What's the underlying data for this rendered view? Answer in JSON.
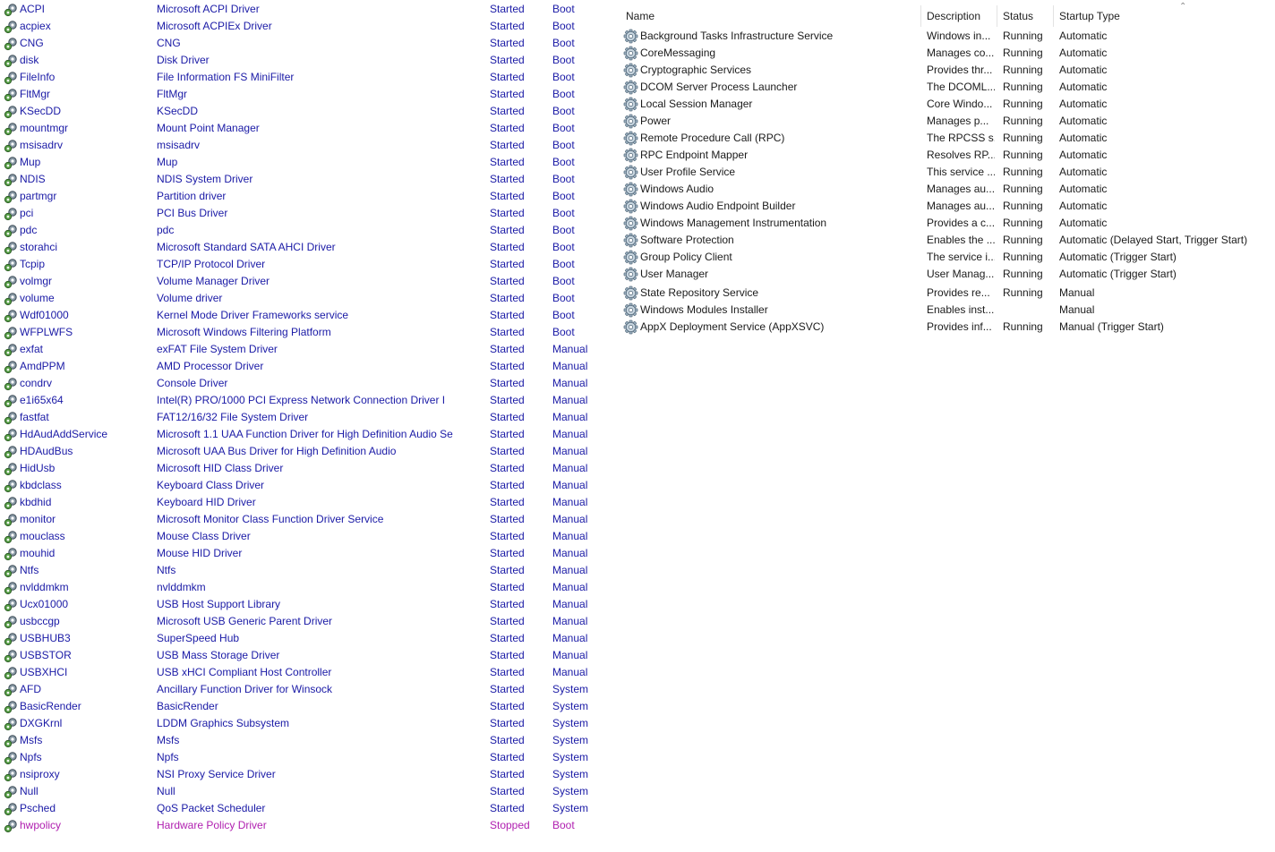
{
  "drivers": [
    {
      "name": "ACPI",
      "desc": "Microsoft ACPI Driver",
      "status": "Started",
      "start": "Boot"
    },
    {
      "name": "acpiex",
      "desc": "Microsoft ACPIEx Driver",
      "status": "Started",
      "start": "Boot"
    },
    {
      "name": "CNG",
      "desc": "CNG",
      "status": "Started",
      "start": "Boot"
    },
    {
      "name": "disk",
      "desc": "Disk Driver",
      "status": "Started",
      "start": "Boot"
    },
    {
      "name": "FileInfo",
      "desc": "File Information FS MiniFilter",
      "status": "Started",
      "start": "Boot"
    },
    {
      "name": "FltMgr",
      "desc": "FltMgr",
      "status": "Started",
      "start": "Boot"
    },
    {
      "name": "KSecDD",
      "desc": "KSecDD",
      "status": "Started",
      "start": "Boot"
    },
    {
      "name": "mountmgr",
      "desc": "Mount Point Manager",
      "status": "Started",
      "start": "Boot"
    },
    {
      "name": "msisadrv",
      "desc": "msisadrv",
      "status": "Started",
      "start": "Boot"
    },
    {
      "name": "Mup",
      "desc": "Mup",
      "status": "Started",
      "start": "Boot"
    },
    {
      "name": "NDIS",
      "desc": "NDIS System Driver",
      "status": "Started",
      "start": "Boot"
    },
    {
      "name": "partmgr",
      "desc": "Partition driver",
      "status": "Started",
      "start": "Boot"
    },
    {
      "name": "pci",
      "desc": "PCI Bus Driver",
      "status": "Started",
      "start": "Boot"
    },
    {
      "name": "pdc",
      "desc": "pdc",
      "status": "Started",
      "start": "Boot"
    },
    {
      "name": "storahci",
      "desc": "Microsoft Standard SATA AHCI Driver",
      "status": "Started",
      "start": "Boot"
    },
    {
      "name": "Tcpip",
      "desc": "TCP/IP Protocol Driver",
      "status": "Started",
      "start": "Boot"
    },
    {
      "name": "volmgr",
      "desc": "Volume Manager Driver",
      "status": "Started",
      "start": "Boot"
    },
    {
      "name": "volume",
      "desc": "Volume driver",
      "status": "Started",
      "start": "Boot"
    },
    {
      "name": "Wdf01000",
      "desc": "Kernel Mode Driver Frameworks service",
      "status": "Started",
      "start": "Boot"
    },
    {
      "name": "WFPLWFS",
      "desc": "Microsoft Windows Filtering Platform",
      "status": "Started",
      "start": "Boot"
    },
    {
      "name": "exfat",
      "desc": "exFAT File System Driver",
      "status": "Started",
      "start": "Manual"
    },
    {
      "name": "AmdPPM",
      "desc": "AMD Processor Driver",
      "status": "Started",
      "start": "Manual"
    },
    {
      "name": "condrv",
      "desc": "Console Driver",
      "status": "Started",
      "start": "Manual"
    },
    {
      "name": "e1i65x64",
      "desc": "Intel(R) PRO/1000 PCI Express Network Connection Driver I",
      "status": "Started",
      "start": "Manual"
    },
    {
      "name": "fastfat",
      "desc": "FAT12/16/32 File System Driver",
      "status": "Started",
      "start": "Manual"
    },
    {
      "name": "HdAudAddService",
      "desc": "Microsoft 1.1 UAA Function Driver for High Definition Audio Se",
      "status": "Started",
      "start": "Manual"
    },
    {
      "name": "HDAudBus",
      "desc": "Microsoft UAA Bus Driver for High Definition Audio",
      "status": "Started",
      "start": "Manual"
    },
    {
      "name": "HidUsb",
      "desc": "Microsoft HID Class Driver",
      "status": "Started",
      "start": "Manual"
    },
    {
      "name": "kbdclass",
      "desc": "Keyboard Class Driver",
      "status": "Started",
      "start": "Manual"
    },
    {
      "name": "kbdhid",
      "desc": "Keyboard HID Driver",
      "status": "Started",
      "start": "Manual"
    },
    {
      "name": "monitor",
      "desc": "Microsoft Monitor Class Function Driver Service",
      "status": "Started",
      "start": "Manual"
    },
    {
      "name": "mouclass",
      "desc": "Mouse Class Driver",
      "status": "Started",
      "start": "Manual"
    },
    {
      "name": "mouhid",
      "desc": "Mouse HID Driver",
      "status": "Started",
      "start": "Manual"
    },
    {
      "name": "Ntfs",
      "desc": "Ntfs",
      "status": "Started",
      "start": "Manual"
    },
    {
      "name": "nvlddmkm",
      "desc": "nvlddmkm",
      "status": "Started",
      "start": "Manual"
    },
    {
      "name": "Ucx01000",
      "desc": "USB Host Support Library",
      "status": "Started",
      "start": "Manual"
    },
    {
      "name": "usbccgp",
      "desc": "Microsoft USB Generic Parent Driver",
      "status": "Started",
      "start": "Manual"
    },
    {
      "name": "USBHUB3",
      "desc": "SuperSpeed Hub",
      "status": "Started",
      "start": "Manual"
    },
    {
      "name": "USBSTOR",
      "desc": "USB Mass Storage Driver",
      "status": "Started",
      "start": "Manual"
    },
    {
      "name": "USBXHCI",
      "desc": "USB xHCI Compliant Host Controller",
      "status": "Started",
      "start": "Manual"
    },
    {
      "name": "AFD",
      "desc": "Ancillary Function Driver for Winsock",
      "status": "Started",
      "start": "System"
    },
    {
      "name": "BasicRender",
      "desc": "BasicRender",
      "status": "Started",
      "start": "System"
    },
    {
      "name": "DXGKrnl",
      "desc": "LDDM Graphics Subsystem",
      "status": "Started",
      "start": "System"
    },
    {
      "name": "Msfs",
      "desc": "Msfs",
      "status": "Started",
      "start": "System"
    },
    {
      "name": "Npfs",
      "desc": "Npfs",
      "status": "Started",
      "start": "System"
    },
    {
      "name": "nsiproxy",
      "desc": "NSI Proxy Service Driver",
      "status": "Started",
      "start": "System"
    },
    {
      "name": "Null",
      "desc": "Null",
      "status": "Started",
      "start": "System"
    },
    {
      "name": "Psched",
      "desc": "QoS Packet Scheduler",
      "status": "Started",
      "start": "System"
    },
    {
      "name": "hwpolicy",
      "desc": "Hardware Policy Driver",
      "status": "Stopped",
      "start": "Boot"
    }
  ],
  "services": {
    "columns": {
      "name": "Name",
      "description": "Description",
      "status": "Status",
      "startup": "Startup Type"
    },
    "rows": [
      {
        "name": "Background Tasks Infrastructure Service",
        "desc": "Windows in...",
        "status": "Running",
        "start": "Automatic"
      },
      {
        "name": "CoreMessaging",
        "desc": "Manages co...",
        "status": "Running",
        "start": "Automatic"
      },
      {
        "name": "Cryptographic Services",
        "desc": "Provides thr...",
        "status": "Running",
        "start": "Automatic"
      },
      {
        "name": "DCOM Server Process Launcher",
        "desc": "The DCOML...",
        "status": "Running",
        "start": "Automatic"
      },
      {
        "name": "Local Session Manager",
        "desc": "Core Windo...",
        "status": "Running",
        "start": "Automatic"
      },
      {
        "name": "Power",
        "desc": "Manages p...",
        "status": "Running",
        "start": "Automatic"
      },
      {
        "name": "Remote Procedure Call (RPC)",
        "desc": "The RPCSS s...",
        "status": "Running",
        "start": "Automatic"
      },
      {
        "name": "RPC Endpoint Mapper",
        "desc": "Resolves RP...",
        "status": "Running",
        "start": "Automatic"
      },
      {
        "name": "User Profile Service",
        "desc": "This service ...",
        "status": "Running",
        "start": "Automatic"
      },
      {
        "name": "Windows Audio",
        "desc": "Manages au...",
        "status": "Running",
        "start": "Automatic"
      },
      {
        "name": "Windows Audio Endpoint Builder",
        "desc": "Manages au...",
        "status": "Running",
        "start": "Automatic"
      },
      {
        "name": "Windows Management Instrumentation",
        "desc": "Provides a c...",
        "status": "Running",
        "start": "Automatic"
      },
      {
        "name": "Software Protection",
        "desc": "Enables the ...",
        "status": "Running",
        "start": "Automatic (Delayed Start, Trigger Start)"
      },
      {
        "name": "Group Policy Client",
        "desc": "The service i...",
        "status": "Running",
        "start": "Automatic (Trigger Start)"
      },
      {
        "name": "User Manager",
        "desc": "User Manag...",
        "status": "Running",
        "start": "Automatic (Trigger Start)"
      },
      {
        "name": "State Repository Service",
        "desc": "Provides re...",
        "status": "Running",
        "start": "Manual"
      },
      {
        "name": "Windows Modules Installer",
        "desc": "Enables inst...",
        "status": "",
        "start": "Manual"
      },
      {
        "name": "AppX Deployment Service (AppXSVC)",
        "desc": "Provides inf...",
        "status": "Running",
        "start": "Manual (Trigger Start)"
      }
    ]
  },
  "colors": {
    "running_text": "#1a1aa6",
    "stopped_text": "#b01fb0"
  },
  "icons": {
    "driver": "gears-icon",
    "service": "gear-icon",
    "sort": "sort-ascending-icon"
  }
}
